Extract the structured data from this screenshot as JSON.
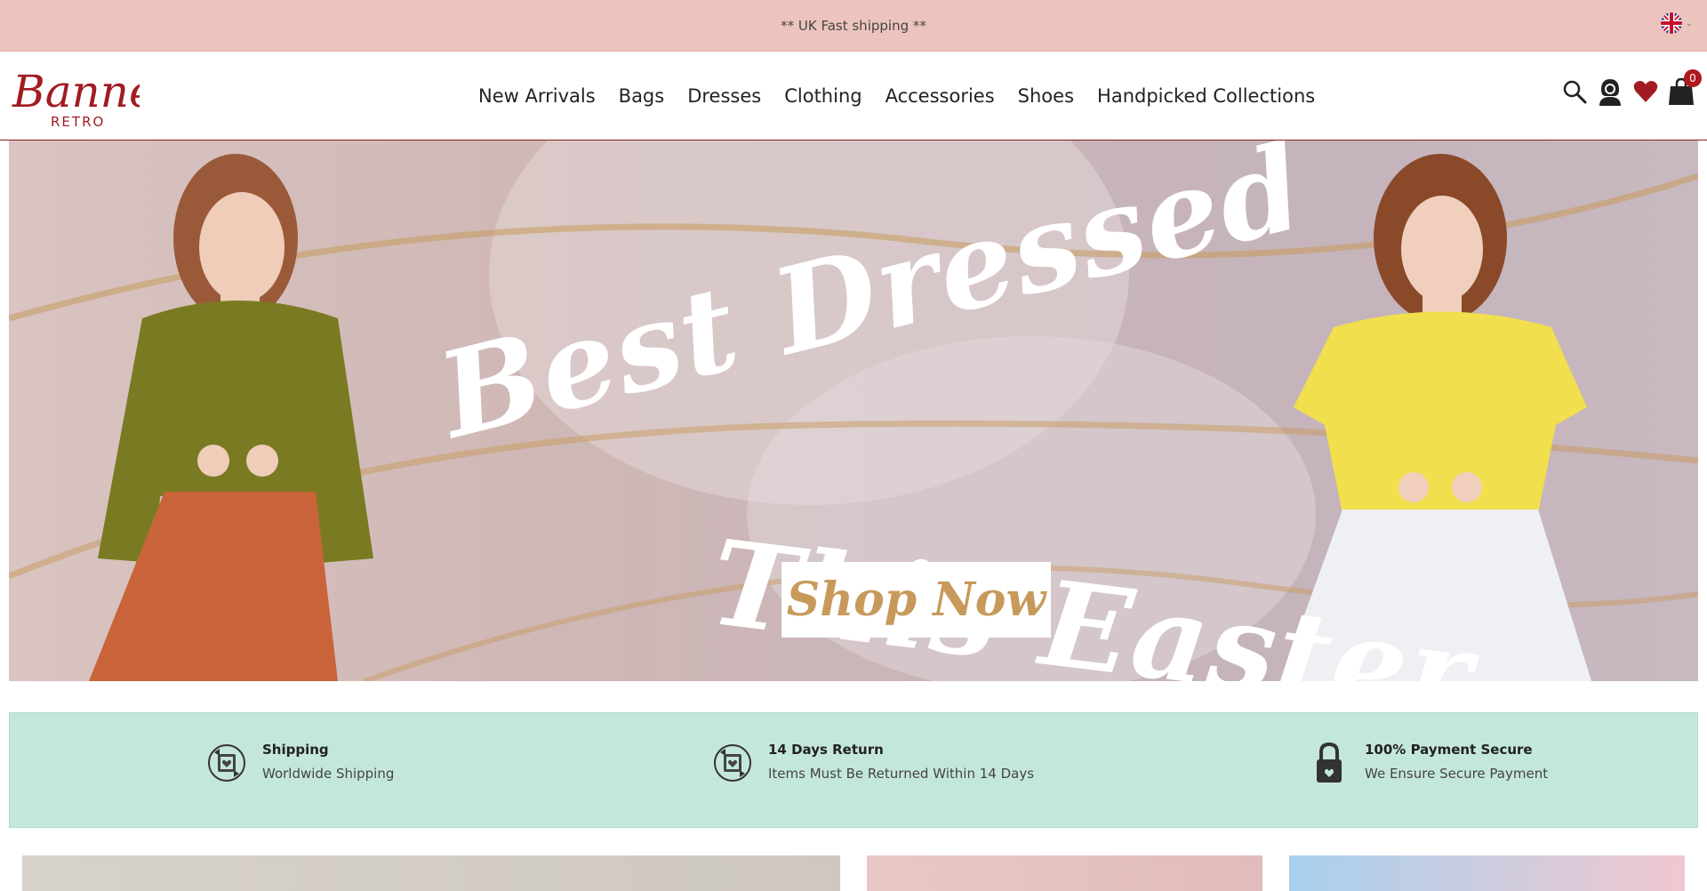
{
  "topbar": {
    "text": "** UK Fast shipping **",
    "language_icon": "uk-flag-icon"
  },
  "header": {
    "logo": {
      "main": "Banned",
      "sub": "RETRO"
    },
    "nav": [
      "New Arrivals",
      "Bags",
      "Dresses",
      "Clothing",
      "Accessories",
      "Shoes",
      "Handpicked Collections"
    ],
    "icons": {
      "search": "search-icon",
      "account": "account-icon",
      "wishlist": "heart-icon",
      "cart": "bag-icon",
      "cart_count": "0"
    }
  },
  "hero": {
    "line1": "Best Dressed",
    "line2": "This Easter",
    "cta": "Shop Now"
  },
  "features": [
    {
      "icon": "shipping-icon",
      "title": "Shipping",
      "desc": "Worldwide Shipping"
    },
    {
      "icon": "return-icon",
      "title": "14 Days Return",
      "desc": "Items Must Be Returned Within 14 Days"
    },
    {
      "icon": "lock-icon",
      "title": "100% Payment Secure",
      "desc": "We Ensure Secure Payment"
    }
  ],
  "colors": {
    "topbar": "#edc4bd",
    "brand": "#a01c22",
    "features_bg": "#c4e7dc",
    "cta_text": "#c79a5b"
  }
}
